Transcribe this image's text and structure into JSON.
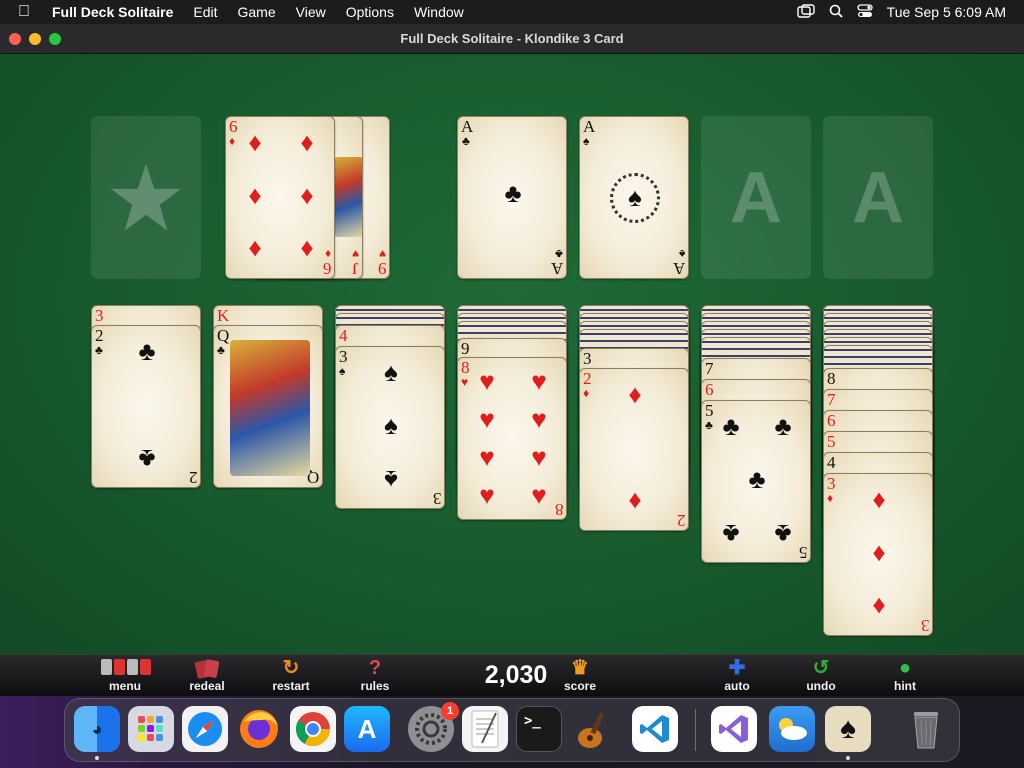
{
  "menubar": {
    "app_name": "Full Deck Solitaire",
    "items": [
      "Edit",
      "Game",
      "View",
      "Options",
      "Window"
    ],
    "clock": "Tue Sep 5  6:09 AM"
  },
  "window": {
    "title": "Full Deck Solitaire - Klondike 3 Card"
  },
  "foundations": [
    {
      "rank": "A",
      "suit": "♣",
      "color": "black"
    },
    {
      "rank": "A",
      "suit": "♠",
      "color": "black"
    },
    {
      "rank": "A",
      "suit": "",
      "empty": true
    },
    {
      "rank": "A",
      "suit": "",
      "empty": true
    }
  ],
  "waste": [
    {
      "rank": "9",
      "suit": "♥",
      "color": "red"
    },
    {
      "rank": "J",
      "suit": "♥",
      "color": "red"
    },
    {
      "rank": "6",
      "suit": "♦",
      "color": "red"
    }
  ],
  "tableau": [
    {
      "hidden": 0,
      "cards": [
        {
          "rank": "3",
          "suit": "♥",
          "color": "red"
        },
        {
          "rank": "2",
          "suit": "♣",
          "color": "black"
        }
      ]
    },
    {
      "hidden": 0,
      "cards": [
        {
          "rank": "K",
          "suit": "♥",
          "color": "red"
        },
        {
          "rank": "Q",
          "suit": "♣",
          "color": "black"
        }
      ]
    },
    {
      "hidden": 2,
      "cards": [
        {
          "rank": "4",
          "suit": "♥",
          "color": "red"
        },
        {
          "rank": "3",
          "suit": "♠",
          "color": "black"
        }
      ]
    },
    {
      "hidden": 3,
      "cards": [
        {
          "rank": "9",
          "suit": "♠",
          "color": "black"
        },
        {
          "rank": "8",
          "suit": "♥",
          "color": "red"
        }
      ]
    },
    {
      "hidden": 4,
      "cards": [
        {
          "rank": "3",
          "suit": "♠",
          "color": "black"
        },
        {
          "rank": "2",
          "suit": "♦",
          "color": "red"
        }
      ]
    },
    {
      "hidden": 5,
      "cards": [
        {
          "rank": "7",
          "suit": "♠",
          "color": "black"
        },
        {
          "rank": "6",
          "suit": "♥",
          "color": "red"
        },
        {
          "rank": "5",
          "suit": "♣",
          "color": "black"
        }
      ]
    },
    {
      "hidden": 6,
      "cards": [
        {
          "rank": "8",
          "suit": "♠",
          "color": "black"
        },
        {
          "rank": "7",
          "suit": "♦",
          "color": "red"
        },
        {
          "rank": "6",
          "suit": "♦",
          "color": "red"
        },
        {
          "rank": "5",
          "suit": "♦",
          "color": "red"
        },
        {
          "rank": "4",
          "suit": "♠",
          "color": "black"
        },
        {
          "rank": "3",
          "suit": "♦",
          "color": "red"
        }
      ]
    }
  ],
  "toolbar": {
    "menu": "menu",
    "redeal": "redeal",
    "restart": "restart",
    "rules": "rules",
    "score_value": "2,030",
    "score": "score",
    "auto": "auto",
    "undo": "undo",
    "hint": "hint"
  },
  "dock": {
    "items": [
      {
        "name": "Finder",
        "icon": "finder-icon",
        "color": "#2d8df0"
      },
      {
        "name": "Launchpad",
        "icon": "launchpad-icon",
        "color": "#d0d4e0"
      },
      {
        "name": "Safari",
        "icon": "safari-icon",
        "color": "#1b8cf2"
      },
      {
        "name": "Firefox",
        "icon": "firefox-icon",
        "color": "#ff7a18"
      },
      {
        "name": "Chrome",
        "icon": "chrome-icon",
        "color": "#f5f5f5"
      },
      {
        "name": "App Store",
        "icon": "app-store-icon",
        "color": "#1d7ff5"
      },
      {
        "name": "System Settings",
        "icon": "settings-icon",
        "color": "#8e8e93",
        "badge": "1"
      },
      {
        "name": "TextEdit",
        "icon": "textedit-icon",
        "color": "#f2f2f2"
      },
      {
        "name": "Terminal",
        "icon": "terminal-icon",
        "color": "#1a1a1a"
      },
      {
        "name": "GarageBand",
        "icon": "garageband-icon",
        "color": "#3a2a1a"
      },
      {
        "name": "VS Code",
        "icon": "vscode-icon",
        "color": "#ffffff"
      },
      {
        "name": "Visual Studio",
        "icon": "visual-studio-icon",
        "color": "#ffffff"
      },
      {
        "name": "Weather",
        "icon": "weather-icon",
        "color": "#2f86e8"
      },
      {
        "name": "Full Deck Solitaire",
        "icon": "solitaire-icon",
        "color": "#e8dcc0"
      },
      {
        "name": "Trash",
        "icon": "trash-icon",
        "color": "#6a6a70"
      }
    ]
  }
}
